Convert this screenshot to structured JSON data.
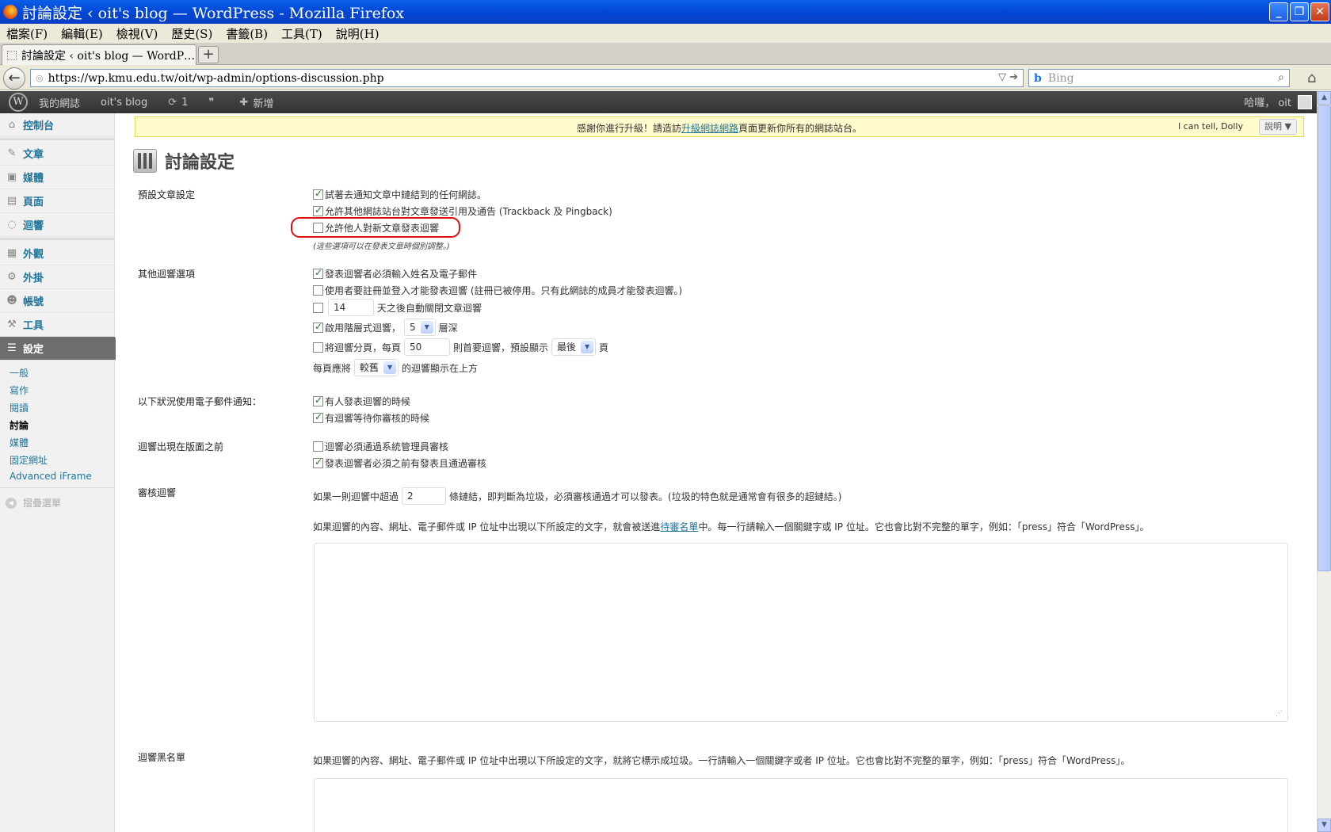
{
  "window": {
    "title": "討論設定 ‹ oit's blog — WordPress - Mozilla Firefox"
  },
  "menubar": [
    "檔案(F)",
    "編輯(E)",
    "檢視(V)",
    "歷史(S)",
    "書籤(B)",
    "工具(T)",
    "說明(H)"
  ],
  "tab": {
    "label": "討論設定 ‹ oit's blog — WordP…",
    "new_tab": "+"
  },
  "nav": {
    "url": "https://wp.kmu.edu.tw/oit/wp-admin/options-discussion.php",
    "search_placeholder": "Bing",
    "search_engine": "b"
  },
  "adminbar": {
    "logo": "W",
    "my_sites": "我的網誌",
    "site_name": "oit's blog",
    "updates_icon": "⟳",
    "updates_count": "1",
    "comments_icon": "💬",
    "new_label": "新增",
    "greeting": "哈囉， oit"
  },
  "sidebar": {
    "items": [
      {
        "label": "控制台",
        "icon": "⌂"
      },
      {
        "label": "文章",
        "icon": "✎"
      },
      {
        "label": "媒體",
        "icon": "▣"
      },
      {
        "label": "頁面",
        "icon": "▤"
      },
      {
        "label": "迴響",
        "icon": "◌"
      },
      {
        "label": "外觀",
        "icon": "▦"
      },
      {
        "label": "外掛",
        "icon": "⚙"
      },
      {
        "label": "帳號",
        "icon": "☻"
      },
      {
        "label": "工具",
        "icon": "⚒"
      },
      {
        "label": "設定",
        "icon": "☰"
      }
    ],
    "submenu": [
      "一般",
      "寫作",
      "閱讀",
      "討論",
      "媒體",
      "固定網址",
      "Advanced iFrame"
    ],
    "collapse": "摺疊選單"
  },
  "notice": {
    "text_before": "感謝你進行升級！請造訪",
    "link": "升級網誌網路",
    "text_after": "頁面更新你所有的網誌站台。",
    "dolly": "I can tell, Dolly",
    "help": "說明 ▼"
  },
  "page_title": "討論設定",
  "sections": {
    "default_article": {
      "label": "預設文章設定",
      "opt1": "試著去通知文章中鏈結到的任何網誌。",
      "opt2": "允許其他網誌站台對文章發送引用及通告 (Trackback 及 Pingback)",
      "opt3": "允許他人對新文章發表迴響",
      "note": "(這些選項可以在發表文章時個別調整。)"
    },
    "other": {
      "label": "其他迴響選項",
      "opt1": "發表迴響者必須輸入姓名及電子郵件",
      "opt2": "使用者要註冊並登入才能發表迴響 (註冊已被停用。只有此網誌的成員才能發表迴響。)",
      "close_days": "14",
      "close_suffix": "天之後自動關閉文章迴響",
      "threaded_prefix": "啟用階層式迴響，",
      "threaded_depth": "5",
      "threaded_suffix": "層深",
      "paged_prefix": "將迴響分頁，每頁",
      "paged_count": "50",
      "paged_mid": "則首要迴響，預設顯示",
      "paged_which": "最後",
      "paged_suffix": "頁",
      "order_prefix": "每頁應將",
      "order_value": "較舊",
      "order_suffix": "的迴響顯示在上方"
    },
    "email": {
      "label": "以下狀況使用電子郵件通知：",
      "opt1": "有人發表迴響的時候",
      "opt2": "有迴響等待你審核的時候"
    },
    "before_appears": {
      "label": "迴響出現在版面之前",
      "opt1": "迴響必須通過系統管理員審核",
      "opt2": "發表迴響者必須之前有發表且通過審核"
    },
    "moderation": {
      "label": "審核迴響",
      "links_prefix": "如果一則迴響中超過",
      "links_count": "2",
      "links_suffix": "條鏈結，即判斷為垃圾，必須審核通過才可以發表。(垃圾的特色就是通常會有很多的超鏈結。)",
      "words_before": "如果迴響的內容、網址、電子郵件或 IP 位址中出現以下所設定的文字，就會被送進",
      "words_link": "待審名單",
      "words_after": "中。每一行請輸入一個關鍵字或 IP 位址。它也會比對不完整的單字，例如：「press」符合「WordPress」。"
    },
    "blacklist": {
      "label": "迴響黑名單",
      "text": "如果迴響的內容、網址、電子郵件或 IP 位址中出現以下所設定的文字，就將它標示成垃圾。一行請輸入一個關鍵字或者 IP 位址。它也會比對不完整的單字，例如：「press」符合「WordPress」。"
    }
  },
  "colors": {
    "wp_link": "#21759b",
    "highlight": "#e01010",
    "notice_bg": "#fffbcc"
  }
}
